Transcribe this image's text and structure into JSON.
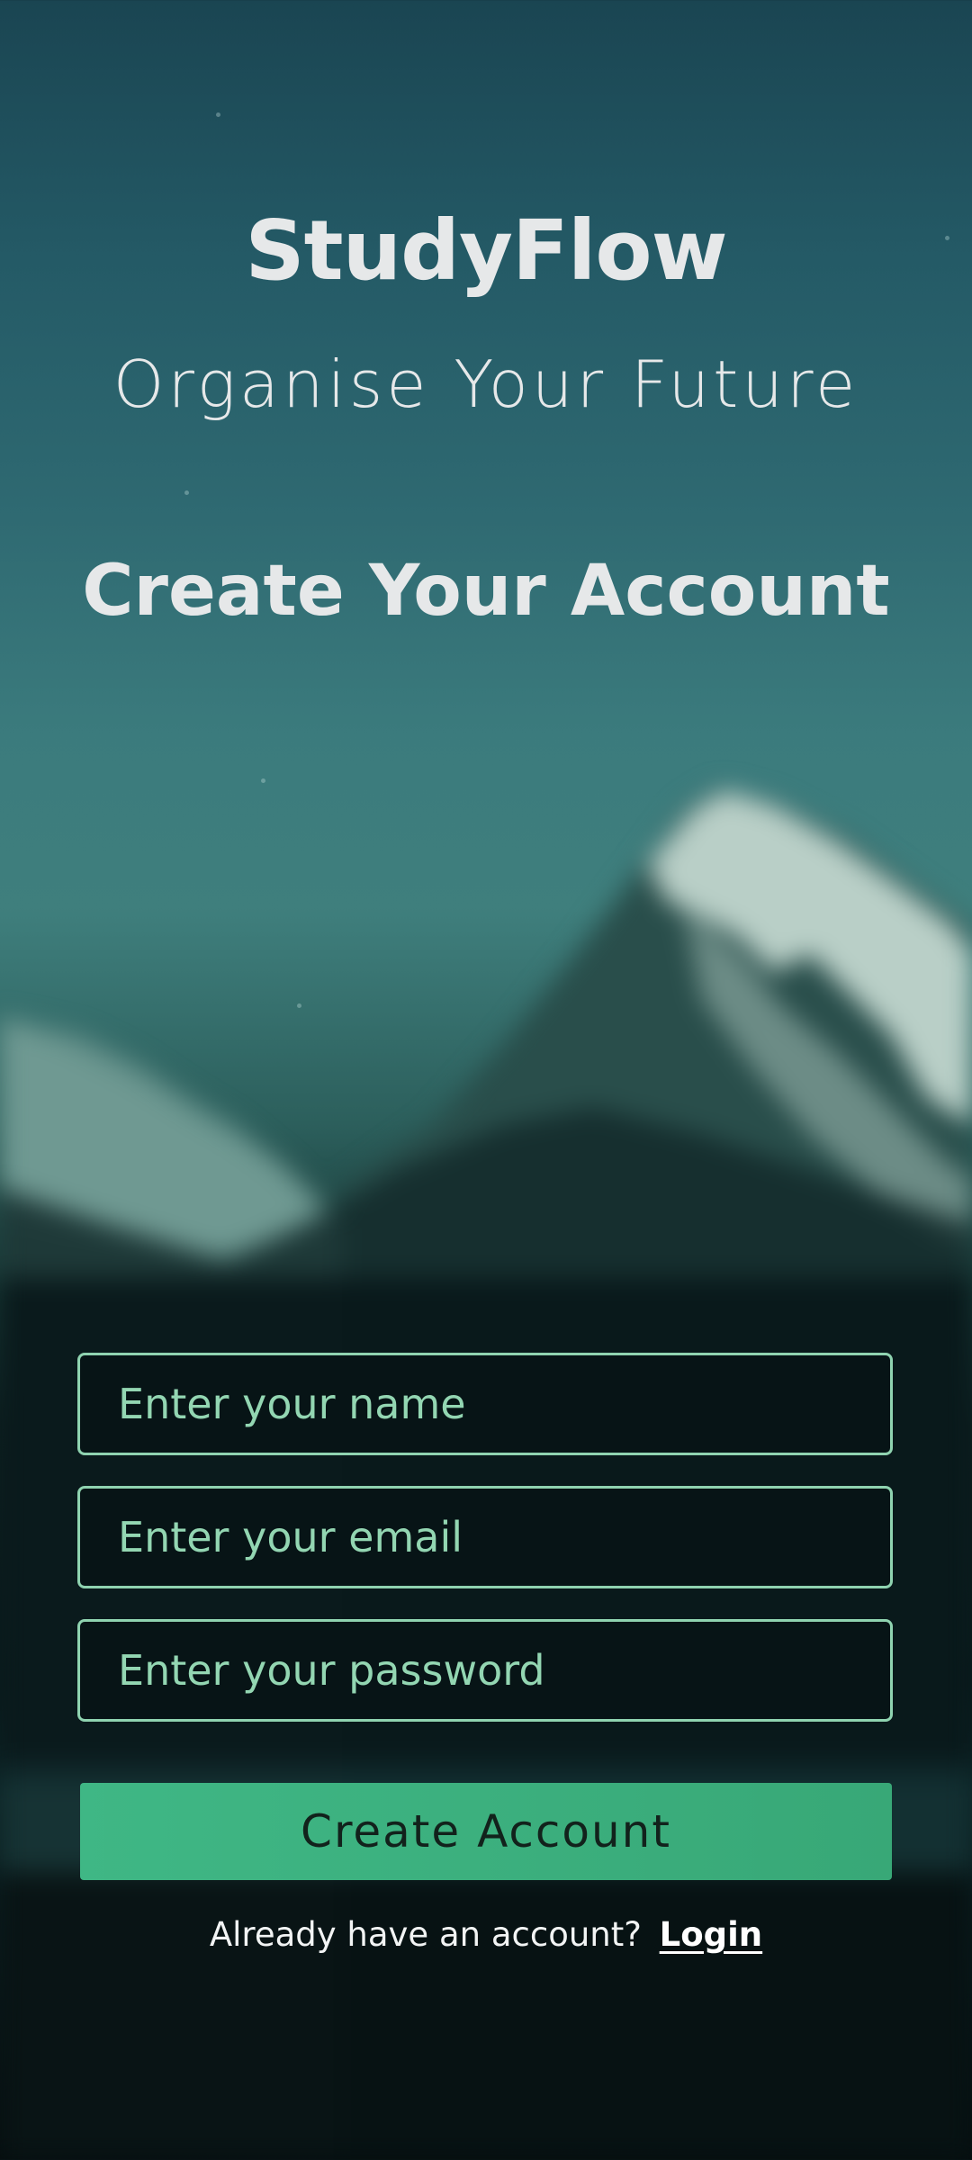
{
  "app": {
    "title": "StudyFlow",
    "tagline": "Organise Your Future"
  },
  "form": {
    "heading": "Create Your Account",
    "name_placeholder": "Enter your name",
    "email_placeholder": "Enter your email",
    "password_placeholder": "Enter your password",
    "submit_label": "Create Account"
  },
  "footer": {
    "prompt": "Already have an account?",
    "login_label": "Login"
  },
  "colors": {
    "accent": "#3fb785",
    "field_border": "#8fd3b0",
    "text": "#e6e8e9"
  },
  "background": "blurred-mountain-landscape"
}
